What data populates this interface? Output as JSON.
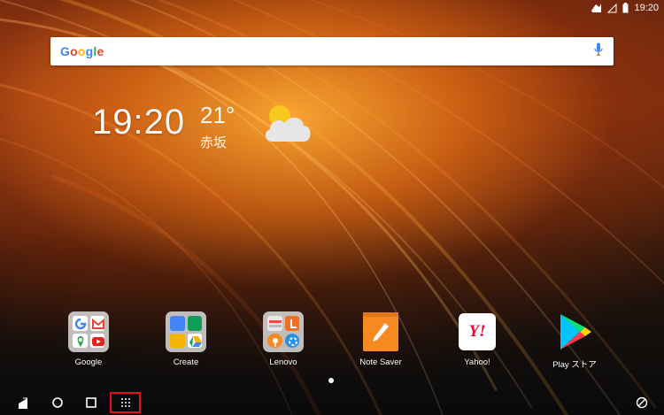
{
  "status_bar": {
    "time": "19:20",
    "icons": [
      "notification-icon",
      "signal-icon",
      "battery-icon"
    ]
  },
  "search": {
    "logo_letters": [
      "G",
      "o",
      "o",
      "g",
      "l",
      "e"
    ],
    "mic_icon": "microphone-icon"
  },
  "clock_widget": {
    "time": "19:20",
    "temperature": "21°",
    "location": "赤坂",
    "weather_icon": "partly-cloudy-icon"
  },
  "apps": [
    {
      "label": "Google",
      "icon": "google-folder-icon"
    },
    {
      "label": "Create",
      "icon": "create-folder-icon"
    },
    {
      "label": "Lenovo",
      "icon": "lenovo-folder-icon"
    },
    {
      "label": "Note Saver",
      "icon": "note-saver-icon"
    },
    {
      "label": "Yahoo!",
      "icon": "yahoo-icon",
      "icon_text": "Y!"
    },
    {
      "label": "Play ストア",
      "icon": "play-store-icon"
    }
  ],
  "nav_bar": {
    "buttons": [
      "back-icon",
      "home-icon",
      "recents-icon",
      "app-drawer-icon",
      "rotation-icon"
    ]
  },
  "colors": {
    "highlight": "#e8101a",
    "note_saver": "#f6891f",
    "yahoo_red": "#ff0033"
  }
}
